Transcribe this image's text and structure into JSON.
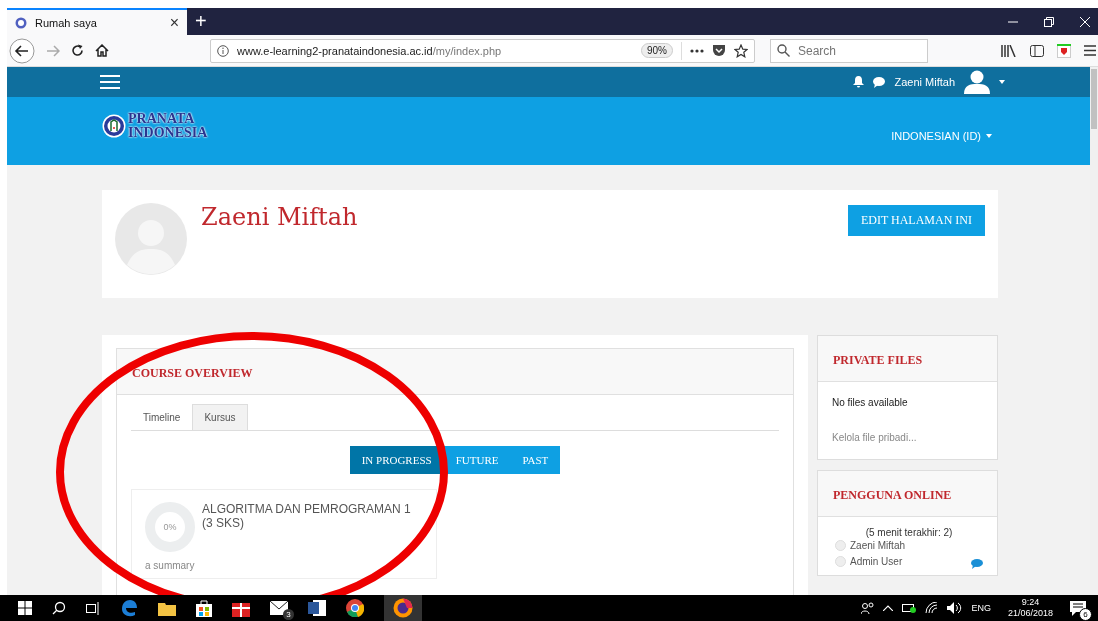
{
  "browser": {
    "tab": {
      "title": "Rumah saya",
      "close": "×"
    },
    "new_tab": "+",
    "url_host": "www.e-learning2-pranataindonesia.ac.id",
    "url_path": "/my/index.php",
    "zoom": "90%",
    "search": {
      "placeholder": "Search"
    }
  },
  "navbar": {
    "user_name": "Zaeni Miftah"
  },
  "header": {
    "logo_lines": [
      "PRANATA",
      "INDONESIA"
    ],
    "language": "INDONESIAN (ID)"
  },
  "profile": {
    "name": "Zaeni Miftah",
    "edit_button": "EDIT HALAMAN INI"
  },
  "course_overview": {
    "title": "COURSE OVERVIEW",
    "tabs": [
      {
        "label": "Timeline",
        "selected": false
      },
      {
        "label": "Kursus",
        "selected": true
      }
    ],
    "filters": [
      {
        "label": "IN PROGRESS",
        "selected": true
      },
      {
        "label": "FUTURE",
        "selected": false
      },
      {
        "label": "PAST",
        "selected": false
      }
    ],
    "course": {
      "title": "ALGORITMA DAN PEMROGRAMAN 1 (3 SKS)",
      "progress": "0%",
      "summary": "a summary"
    }
  },
  "private_files": {
    "title": "PRIVATE FILES",
    "empty_text": "No files available",
    "link": "Kelola file pribadi..."
  },
  "online_users": {
    "title": "PENGGUNA ONLINE",
    "subtitle": "(5 menit terakhir: 2)",
    "users": [
      "Zaeni Miftah",
      "Admin User"
    ]
  },
  "taskbar": {
    "mail_badge": "3",
    "language": "ENG",
    "time": "9:24",
    "date": "21/06/2018",
    "notification_count": "6"
  }
}
